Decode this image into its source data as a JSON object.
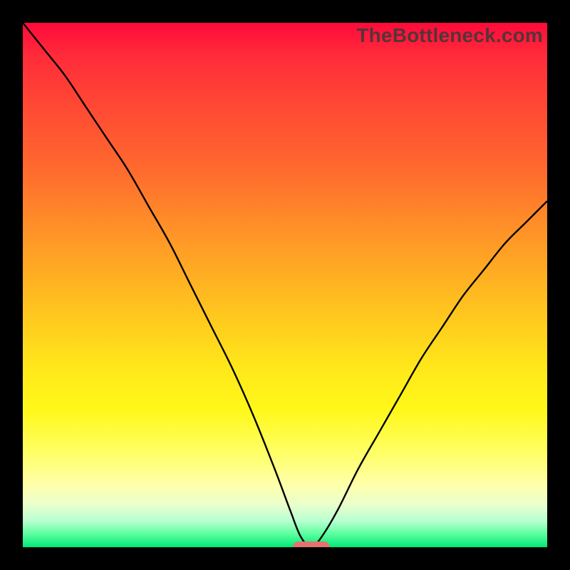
{
  "watermark": "TheBottleneck.com",
  "colors": {
    "curve_stroke": "#000000",
    "marker_fill": "#e4736e"
  },
  "chart_data": {
    "type": "line",
    "title": "",
    "xlabel": "",
    "ylabel": "",
    "xlim": [
      0,
      100
    ],
    "ylim": [
      0,
      100
    ],
    "grid": false,
    "legend": false,
    "annotations": [
      {
        "name": "optimal-marker",
        "x": 55,
        "y": 0
      }
    ],
    "series": [
      {
        "name": "bottleneck-curve",
        "x": [
          0,
          4,
          8,
          12,
          16,
          20,
          24,
          28,
          32,
          36,
          40,
          44,
          48,
          51,
          53,
          55,
          57,
          60,
          64,
          68,
          72,
          76,
          80,
          84,
          88,
          92,
          96,
          100
        ],
        "y": [
          100,
          95,
          90,
          84,
          78,
          72,
          65,
          58,
          50,
          42,
          34,
          25,
          15,
          7,
          2,
          0,
          2,
          7,
          15,
          22,
          29,
          36,
          42,
          48,
          53,
          58,
          62,
          66
        ]
      }
    ]
  }
}
